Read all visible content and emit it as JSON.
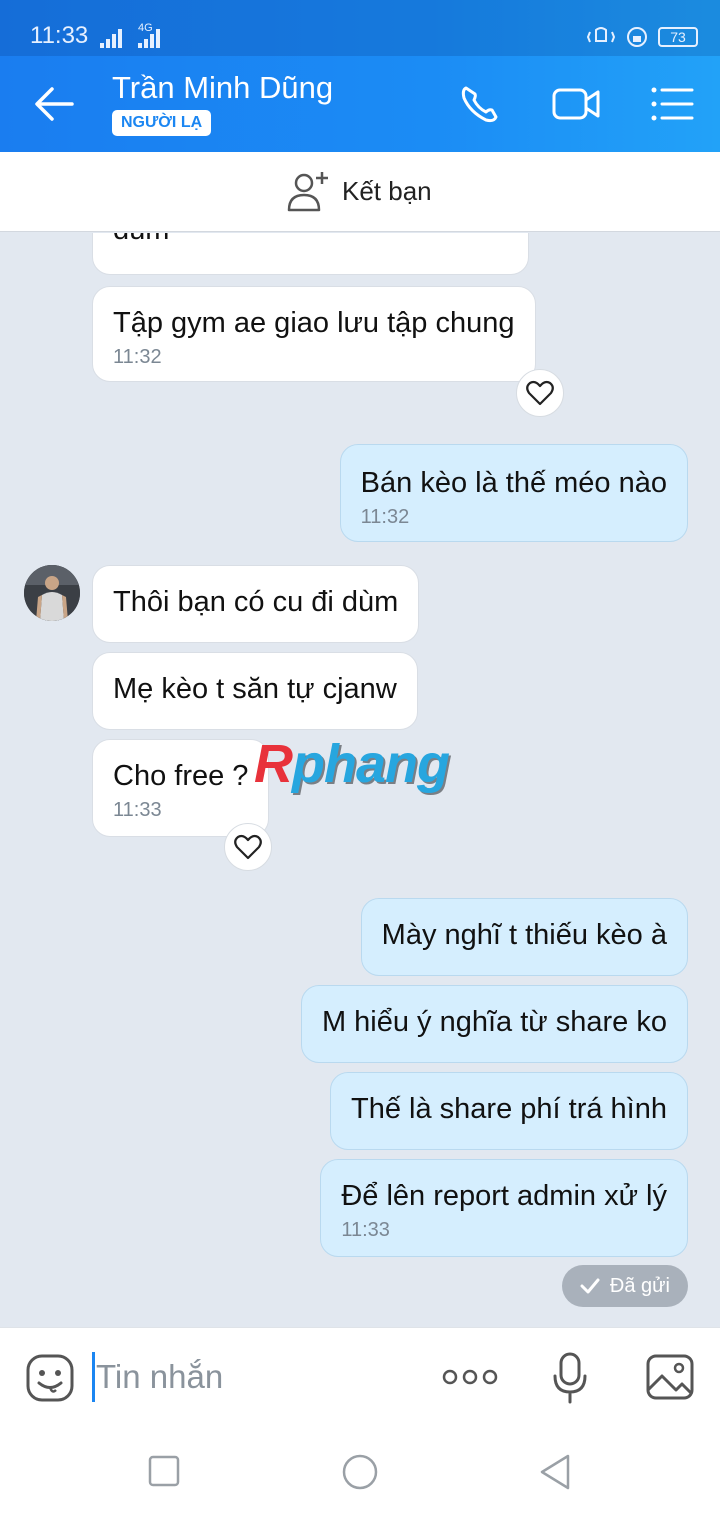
{
  "status_bar": {
    "time": "11:33",
    "network": "4G",
    "battery": "73"
  },
  "header": {
    "contact_name": "Trần Minh Dũng",
    "badge": "NGƯỜI LẠ",
    "icons": [
      "back-arrow-icon",
      "phone-icon",
      "video-call-icon",
      "menu-list-icon"
    ]
  },
  "friend_bar": {
    "label": "Kết bạn",
    "icon": "add-friend-icon"
  },
  "messages": [
    {
      "dir": "in",
      "text": "dùm",
      "time": ""
    },
    {
      "dir": "in",
      "text": "Tập gym ae giao lưu tập chung",
      "time": "11:32"
    },
    {
      "dir": "out",
      "text": "Bán kèo là thế méo nào",
      "time": "11:32"
    },
    {
      "dir": "in",
      "text": "Thôi bạn có cu đi dùm",
      "time": ""
    },
    {
      "dir": "in",
      "text": "Mẹ kèo t săn tự cjanw",
      "time": ""
    },
    {
      "dir": "in",
      "text": "Cho free ?",
      "time": "11:33"
    },
    {
      "dir": "out",
      "text": "Mày nghĩ t thiếu kèo à",
      "time": ""
    },
    {
      "dir": "out",
      "text": "M hiểu ý nghĩa từ share ko",
      "time": ""
    },
    {
      "dir": "out",
      "text": "Thế là share phí trá hình",
      "time": ""
    },
    {
      "dir": "out",
      "text": "Để lên report admin xử lý",
      "time": "11:33"
    }
  ],
  "sent_status": "Đã gửi",
  "watermark": {
    "first": "R",
    "rest": "phang"
  },
  "input": {
    "placeholder": "Tin nhắn",
    "icons": [
      "emoji-icon",
      "more-icon",
      "microphone-icon",
      "image-icon"
    ]
  },
  "nav": [
    "recent-apps-button",
    "home-button",
    "back-button"
  ],
  "colors": {
    "header": "#1b86f2",
    "incoming_bubble": "#ffffff",
    "outgoing_bubble": "#d5eefe",
    "chat_background": "#e2e8f0"
  }
}
